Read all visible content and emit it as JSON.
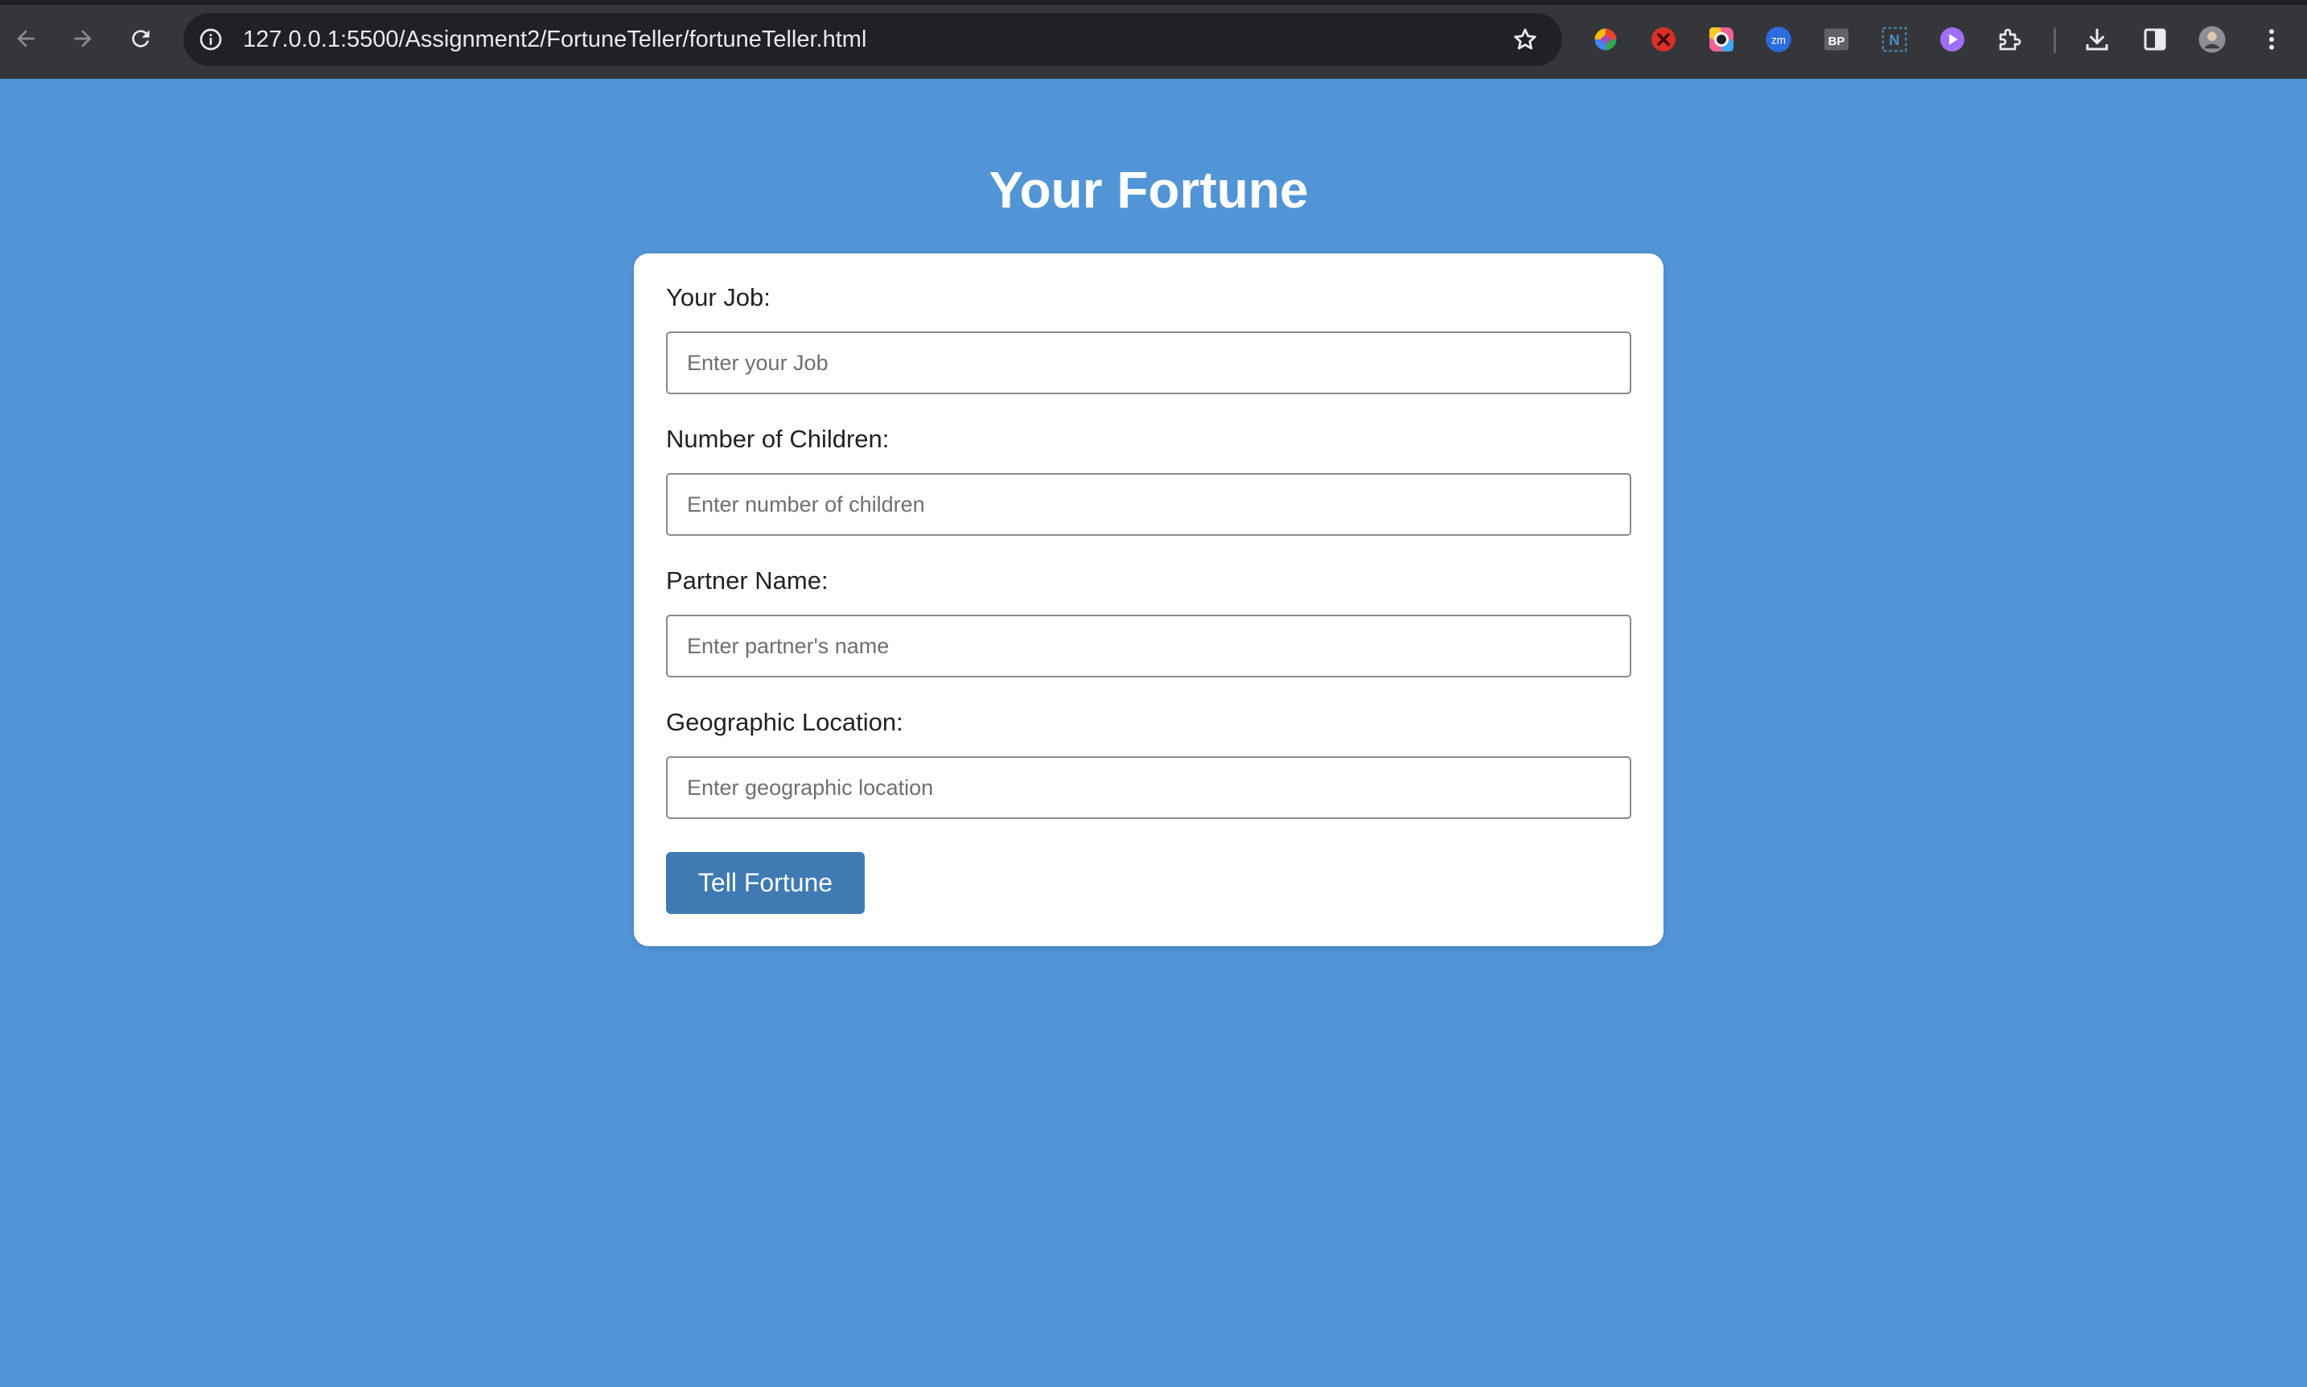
{
  "browser": {
    "url": "127.0.0.1:5500/Assignment2/FortuneTeller/fortuneTeller.html",
    "nav": [
      {
        "icon": "back-arrow-icon"
      },
      {
        "icon": "forward-arrow-icon"
      },
      {
        "icon": "reload-icon"
      }
    ],
    "omnibox_icons": [
      "site-info-icon",
      "bookmark-star-icon"
    ],
    "extensions": [
      {
        "icon": "color-pinwheel-extension-icon"
      },
      {
        "icon": "red-x-extension-icon"
      },
      {
        "icon": "rainbow-ring-extension-icon"
      },
      {
        "icon": "zoom-extension-icon",
        "text": "zm"
      },
      {
        "icon": "bp-extension-icon",
        "text": "BP"
      },
      {
        "icon": "notion-n-extension-icon",
        "text": "N"
      },
      {
        "icon": "purple-play-extension-icon"
      },
      {
        "icon": "puzzle-extensions-icon"
      },
      {
        "icon": "download-icon"
      },
      {
        "icon": "side-panel-icon"
      },
      {
        "icon": "profile-avatar-icon"
      },
      {
        "icon": "kebab-menu-icon"
      }
    ]
  },
  "page": {
    "title": "Your Fortune",
    "background": "#5295d6",
    "form": {
      "fields": [
        {
          "label": "Your Job:",
          "placeholder": "Enter your Job",
          "value": ""
        },
        {
          "label": "Number of Children:",
          "placeholder": "Enter number of children",
          "value": ""
        },
        {
          "label": "Partner Name:",
          "placeholder": "Enter partner's name",
          "value": ""
        },
        {
          "label": "Geographic Location:",
          "placeholder": "Enter geographic location",
          "value": ""
        }
      ],
      "submit_label": "Tell Fortune",
      "submit_color": "#3f7ab3"
    }
  }
}
